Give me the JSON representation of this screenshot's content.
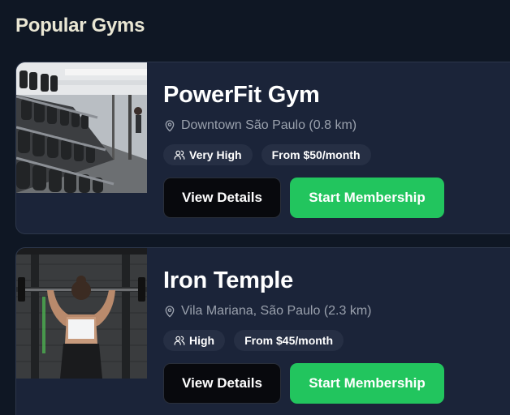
{
  "section": {
    "title": "Popular Gyms"
  },
  "gyms": [
    {
      "name": "PowerFit Gym",
      "location": "Downtown São Paulo (0.8 km)",
      "traffic": "Very High",
      "price": "From $50/month",
      "details_label": "View Details",
      "membership_label": "Start Membership",
      "image": "dumbbell-rack-photo"
    },
    {
      "name": "Iron Temple",
      "location": "Vila Mariana, São Paulo (2.3 km)",
      "traffic": "High",
      "price": "From $45/month",
      "details_label": "View Details",
      "membership_label": "Start Membership",
      "image": "overhead-lift-photo"
    }
  ],
  "icons": {
    "location": "map-pin-icon",
    "traffic": "users-icon"
  },
  "colors": {
    "background": "#0f1724",
    "card": "#1b2439",
    "accent": "#22c55e",
    "badge": "#262f44"
  }
}
